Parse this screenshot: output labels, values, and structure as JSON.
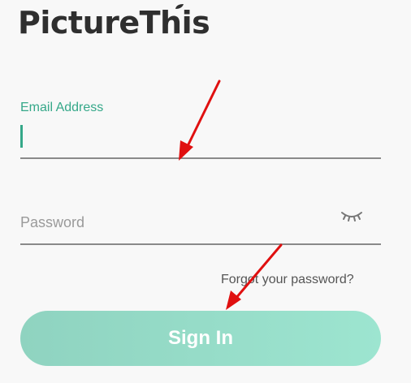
{
  "app": {
    "logo_text": "PictureThis"
  },
  "form": {
    "email": {
      "label": "Email Address",
      "value": ""
    },
    "password": {
      "placeholder": "Password",
      "value": ""
    },
    "toggle_icon": "eye-closed-icon",
    "forgot_label": "Forgot your password?",
    "signin_label": "Sign In"
  },
  "colors": {
    "accent": "#35a889",
    "button_gradient_start": "#8fd3c0",
    "button_gradient_end": "#9de5d0",
    "annotation_arrow": "#e01010"
  }
}
